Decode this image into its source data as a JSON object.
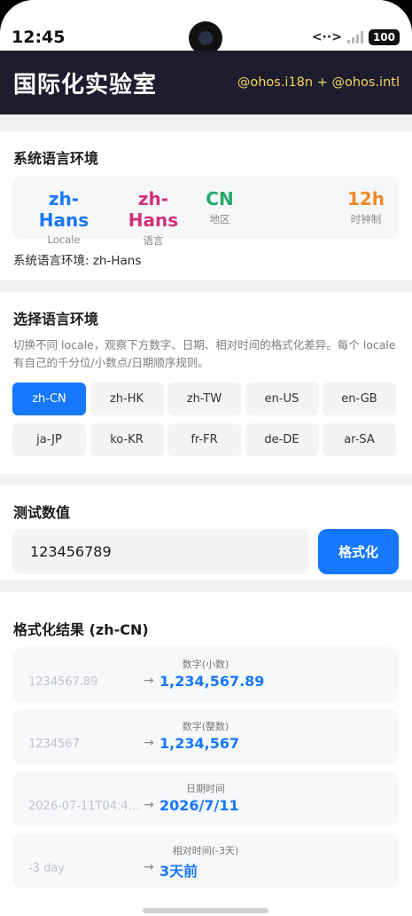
{
  "status_bar": {
    "time": "12:45",
    "network_icon": "<··>",
    "battery": "100"
  },
  "header": {
    "title": "国际化实验室",
    "subtitle": "@ohos.i18n + @ohos.intl",
    "bg_color": "#1c1c2e",
    "subtitle_color": "#f3d45a"
  },
  "system": {
    "title": "系统语言环境",
    "stats": [
      {
        "value": "zh-Hans",
        "label": "Locale",
        "color": "#1677ff"
      },
      {
        "value": "zh-Hans",
        "label": "语言",
        "color": "#d0317a"
      },
      {
        "value": "CN",
        "label": "地区",
        "color": "#28a96b"
      },
      {
        "value": "12h",
        "label": "时钟制",
        "color": "#f08a24"
      }
    ],
    "line": "系统语言环境: zh-Hans"
  },
  "select": {
    "title": "选择语言环境",
    "description": "切换不同 locale，观察下方数字、日期、相对时间的格式化差异。每个 locale 有自己的千分位/小数点/日期顺序规则。",
    "locales": [
      "zh-CN",
      "zh-HK",
      "zh-TW",
      "en-US",
      "en-GB",
      "ja-JP",
      "ko-KR",
      "fr-FR",
      "de-DE",
      "ar-SA"
    ],
    "selected": "zh-CN",
    "accent": "#1677ff"
  },
  "test": {
    "title": "测试数值",
    "value": "123456789",
    "button": "格式化"
  },
  "results": {
    "title": "格式化结果 (zh-CN)",
    "items": [
      {
        "label": "数字(小数)",
        "input": "1234567.89",
        "arrow": "→",
        "output": "1,234,567.89"
      },
      {
        "label": "数字(整数)",
        "input": "1234567",
        "arrow": "→",
        "output": "1,234,567"
      },
      {
        "label": "日期时间",
        "input": "2026-07-11T04:4…",
        "arrow": "→",
        "output": "2026/7/11"
      },
      {
        "label": "相对时间(-3天)",
        "input": "-3 day",
        "arrow": "→",
        "output": "3天前"
      }
    ]
  }
}
